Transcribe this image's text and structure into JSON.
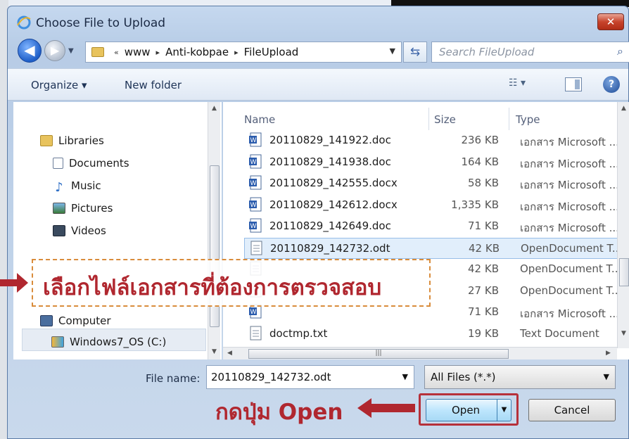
{
  "window": {
    "title": "Choose File to Upload",
    "close_glyph": "✕"
  },
  "address": {
    "back_glyph": "◀",
    "forward_glyph": "▶",
    "breadcrumbs": [
      "www",
      "Anti-kobpae",
      "FileUpload"
    ],
    "lead_sep": "«",
    "sep": "▸",
    "refresh_glyph": "⇆",
    "search_placeholder": "Search FileUpload"
  },
  "toolbar": {
    "organize": "Organize ▾",
    "new_folder": "New folder",
    "view_glyph": "☷ ▾",
    "help_glyph": "?"
  },
  "nav": {
    "libraries": "Libraries",
    "items": [
      "Documents",
      "Music",
      "Pictures",
      "Videos"
    ],
    "computer": "Computer",
    "drive": "Windows7_OS (C:)"
  },
  "columns": {
    "name": "Name",
    "size": "Size",
    "type": "Type"
  },
  "files": [
    {
      "name": "20110829_141922.doc",
      "size": "236 KB",
      "type": "เอกสาร Microsoft ..."
    },
    {
      "name": "20110829_141938.doc",
      "size": "164 KB",
      "type": "เอกสาร Microsoft ..."
    },
    {
      "name": "20110829_142555.docx",
      "size": "58 KB",
      "type": "เอกสาร Microsoft ..."
    },
    {
      "name": "20110829_142612.docx",
      "size": "1,335 KB",
      "type": "เอกสาร Microsoft ..."
    },
    {
      "name": "20110829_142649.doc",
      "size": "71 KB",
      "type": "เอกสาร Microsoft ..."
    },
    {
      "name": "20110829_142732.odt",
      "size": "42 KB",
      "type": "OpenDocument T..."
    },
    {
      "name": "",
      "size": "42 KB",
      "type": "OpenDocument T..."
    },
    {
      "name": "",
      "size": "27 KB",
      "type": "OpenDocument T..."
    },
    {
      "name": "",
      "size": "71 KB",
      "type": "เอกสาร Microsoft ..."
    },
    {
      "name": "doctmp.txt",
      "size": "19 KB",
      "type": "Text Document"
    }
  ],
  "bottom": {
    "filename_label": "File name:",
    "filename_value": "20110829_142732.odt",
    "filetype": "All Files (*.*)",
    "open": "Open",
    "cancel": "Cancel"
  },
  "annotations": {
    "callout": "เลือกไฟล์เอกสารที่ต้องการตรวจสอบ",
    "press_open": "กดปุ่ม Open",
    "color": "#b0272f"
  }
}
